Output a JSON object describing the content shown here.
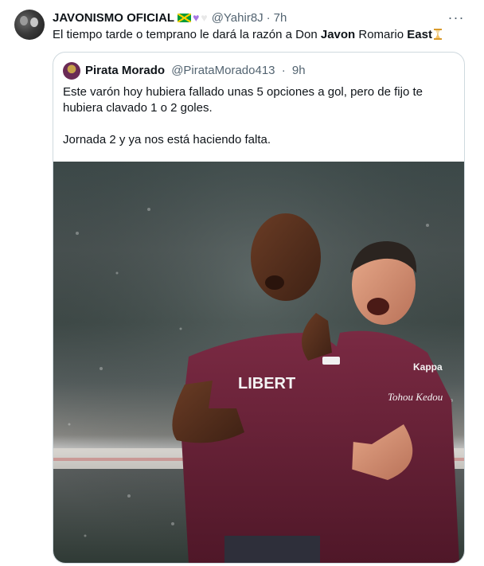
{
  "tweet": {
    "display_name": "JAVONISMO OFICIAL",
    "emojis": [
      "jamaica-flag",
      "purple-heart",
      "white-heart"
    ],
    "handle": "@Yahir8J",
    "separator": "·",
    "time": "7h",
    "more_label": "···",
    "text_parts": {
      "before": "El tiempo tarde o temprano le dará la razón a Don ",
      "bold1": "Javon",
      "middle": " Romario ",
      "bold2": "East"
    },
    "trailing_emoji": "hourglass"
  },
  "quote": {
    "display_name": "Pirata Morado",
    "handle": "@PirataMorado413",
    "separator": "·",
    "time": "9h",
    "paragraph1": "Este varón hoy hubiera fallado unas 5 opciones a gol, pero de fijo te hubiera clavado 1 o 2 goles.",
    "paragraph2": "Jornada 2 y ya nos está haciendo falta.",
    "photo": {
      "jersey_text": "LIBERT",
      "sleeve_text": "Kappa",
      "chest_text": "Tohou Kedou"
    }
  },
  "colors": {
    "text_primary": "#0f1419",
    "text_secondary": "#536471",
    "border": "#cfd9de",
    "jersey": "#6b2238"
  }
}
